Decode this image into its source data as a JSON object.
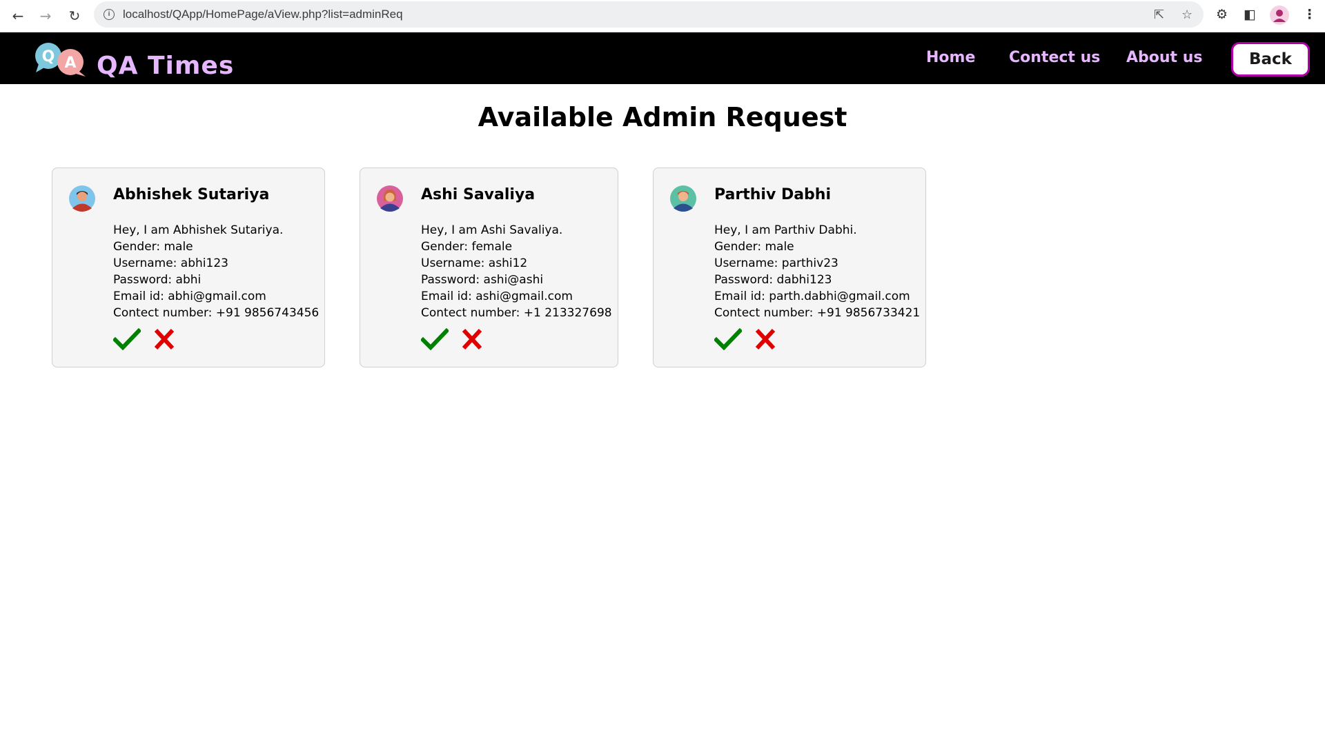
{
  "browser": {
    "url": "localhost/QApp/HomePage/aView.php?list=adminReq"
  },
  "header": {
    "brand": "QA Times",
    "logo_letters": [
      "Q",
      "A"
    ],
    "nav": [
      "Home",
      "Contect us",
      "About us"
    ],
    "back_label": "Back"
  },
  "page": {
    "title": "Available Admin Request"
  },
  "requests": [
    {
      "name": "Abhishek Sutariya",
      "avatar": "male-avatar",
      "intro": "Hey, I am Abhishek Sutariya.",
      "gender": "Gender: male",
      "username": "Username: abhi123",
      "password": "Password: abhi",
      "email": "Email id: abhi@gmail.com",
      "contact": "Contect number: +91 9856743456"
    },
    {
      "name": "Ashi Savaliya",
      "avatar": "female-avatar",
      "intro": "Hey, I am Ashi Savaliya.",
      "gender": "Gender: female",
      "username": "Username: ashi12",
      "password": "Password: ashi@ashi",
      "email": "Email id: ashi@gmail.com",
      "contact": "Contect number: +1 213327698"
    },
    {
      "name": "Parthiv Dabhi",
      "avatar": "male-avatar",
      "intro": "Hey, I am Parthiv Dabhi.",
      "gender": "Gender: male",
      "username": "Username: parthiv23",
      "password": "Password: dabhi123",
      "email": "Email id: parth.dabhi@gmail.com",
      "contact": "Contect number: +91 9856733421"
    }
  ],
  "colors": {
    "header_bg": "#000000",
    "nav_text": "#e6b7ff",
    "back_border": "#b000a8",
    "accept": "#008000",
    "reject": "#e00000",
    "card_bg": "#f5f5f5"
  }
}
